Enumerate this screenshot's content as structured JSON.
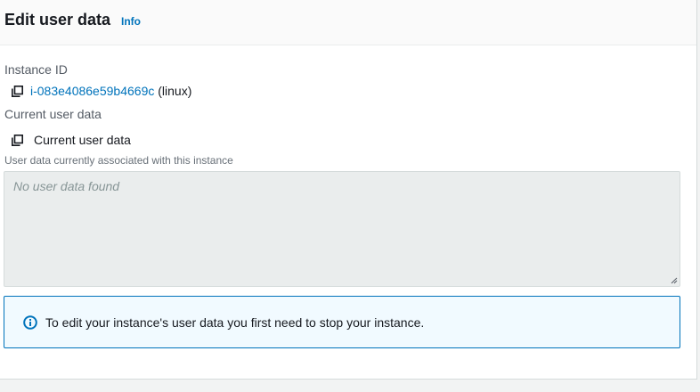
{
  "header": {
    "title": "Edit user data",
    "info_link": "Info"
  },
  "instance": {
    "label": "Instance ID",
    "id": "i-083e4086e59b4669c",
    "platform": "(linux)",
    "copy_icon": "copy-icon"
  },
  "current_user_data": {
    "label": "Current user data",
    "copy_label": "Current user data",
    "copy_icon": "copy-icon",
    "description": "User data currently associated with this instance",
    "placeholder": "No user data found"
  },
  "alert": {
    "icon": "info-circle-icon",
    "message": "To edit your instance's user data you first need to stop your instance.",
    "border_color": "#0073bb",
    "background_color": "#f1faff"
  },
  "colors": {
    "link": "#0073bb",
    "text": "#16191f",
    "muted": "#545b64"
  }
}
